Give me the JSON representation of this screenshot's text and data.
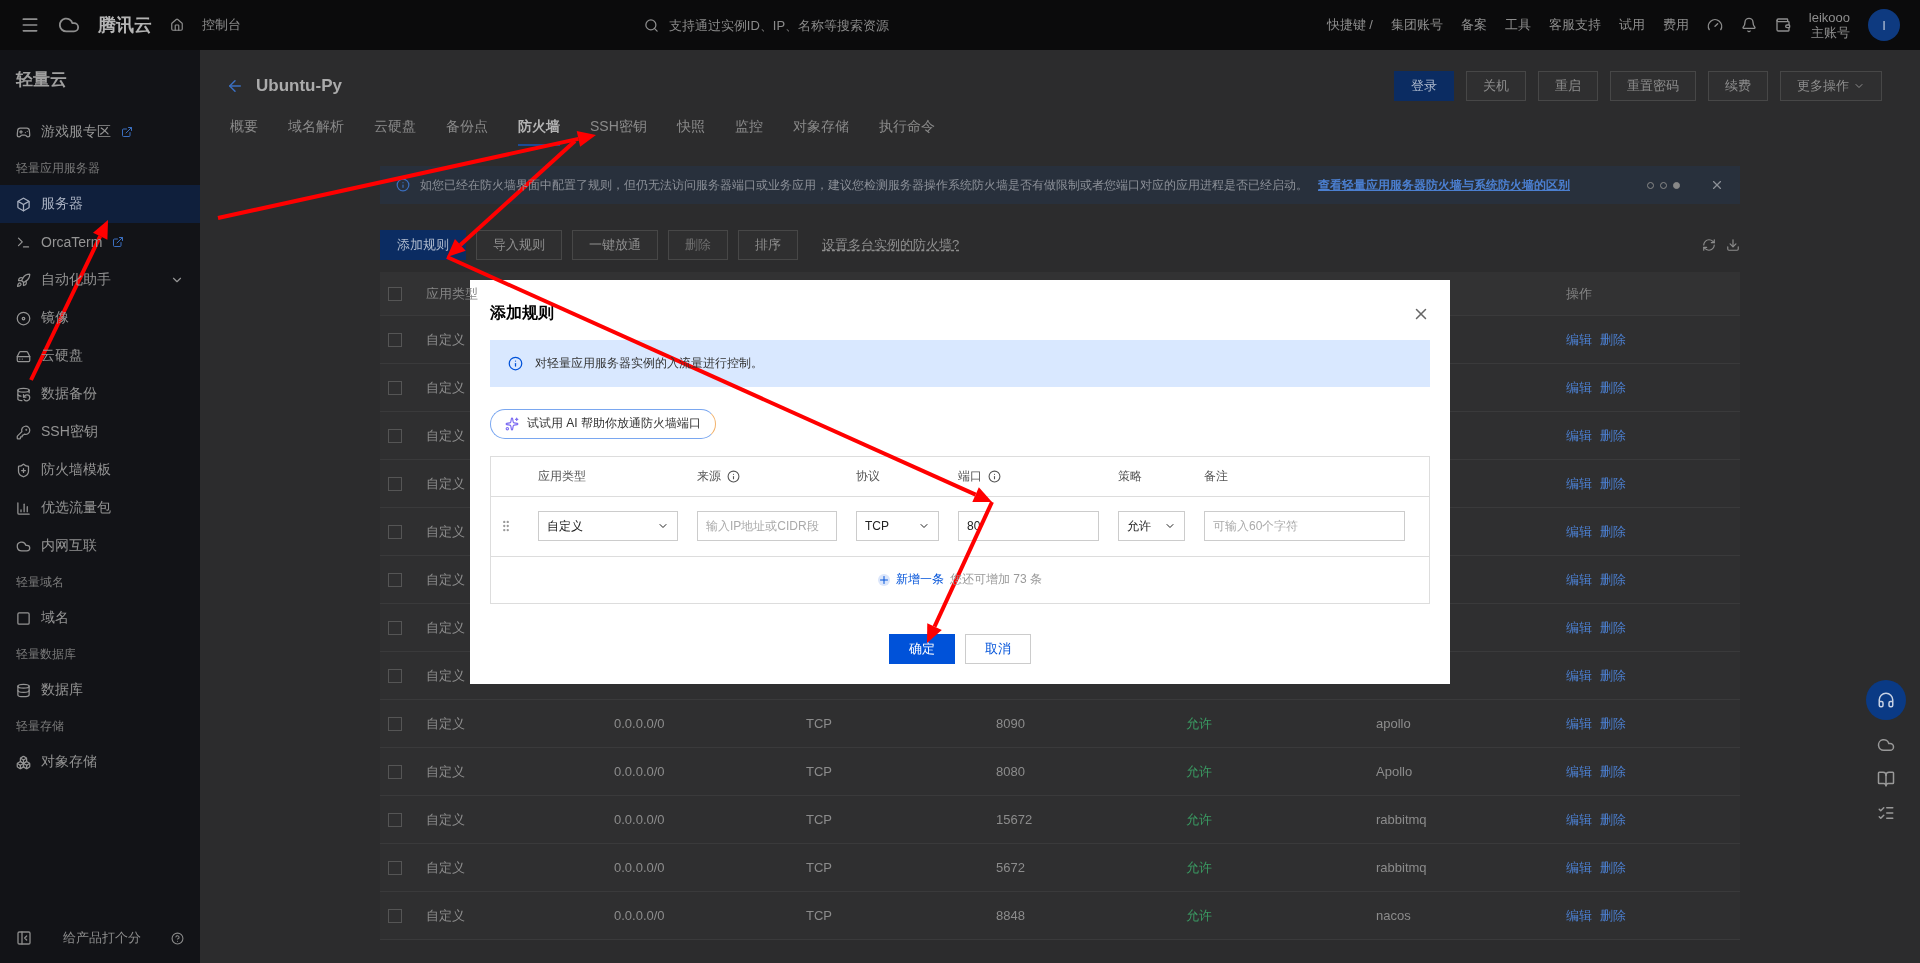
{
  "top_bar": {
    "brand": "腾讯云",
    "console": "控制台",
    "search": {
      "placeholder": "支持通过实例ID、IP、名称等搜索资源"
    },
    "shortcut": "快捷键 /",
    "links": [
      "集团账号",
      "备案",
      "工具",
      "客服支持",
      "试用",
      "费用"
    ],
    "user": {
      "name": "leikooo",
      "role": "主账号",
      "avatar": "I"
    }
  },
  "sidebar": {
    "title": "轻量云",
    "items": [
      {
        "kind": "item",
        "label": "游戏服专区",
        "external": true,
        "selected": false
      },
      {
        "kind": "section",
        "label": "轻量应用服务器"
      },
      {
        "kind": "item",
        "label": "服务器",
        "selected": true
      },
      {
        "kind": "item",
        "label": "OrcaTerm",
        "external": true,
        "selected": false
      },
      {
        "kind": "item",
        "label": "自动化助手",
        "expanded": false,
        "selected": false
      },
      {
        "kind": "item",
        "label": "镜像",
        "selected": false
      },
      {
        "kind": "item",
        "label": "云硬盘",
        "selected": false
      },
      {
        "kind": "item",
        "label": "数据备份",
        "selected": false
      },
      {
        "kind": "item",
        "label": "SSH密钥",
        "selected": false
      },
      {
        "kind": "item",
        "label": "防火墙模板",
        "selected": false
      },
      {
        "kind": "item",
        "label": "优选流量包",
        "selected": false
      },
      {
        "kind": "item",
        "label": "内网互联",
        "selected": false
      },
      {
        "kind": "section",
        "label": "轻量域名"
      },
      {
        "kind": "item",
        "label": "域名",
        "selected": false
      },
      {
        "kind": "section",
        "label": "轻量数据库"
      },
      {
        "kind": "item",
        "label": "数据库",
        "selected": false
      },
      {
        "kind": "section",
        "label": "轻量存储"
      },
      {
        "kind": "item",
        "label": "对象存储",
        "selected": false
      }
    ],
    "feedback": "给产品打个分"
  },
  "page": {
    "title": "Ubuntu-Py",
    "actions": [
      {
        "label": "登录",
        "primary": true
      },
      {
        "label": "关机",
        "primary": false
      },
      {
        "label": "重启",
        "primary": false
      },
      {
        "label": "重置密码",
        "primary": false
      },
      {
        "label": "续费",
        "primary": false
      },
      {
        "label": "更多操作",
        "primary": false,
        "menu": true
      }
    ],
    "tabs": [
      {
        "label": "概要",
        "selected": false
      },
      {
        "label": "域名解析",
        "selected": false
      },
      {
        "label": "云硬盘",
        "selected": false
      },
      {
        "label": "备份点",
        "selected": false
      },
      {
        "label": "防火墙",
        "selected": true
      },
      {
        "label": "SSH密钥",
        "selected": false
      },
      {
        "label": "快照",
        "selected": false
      },
      {
        "label": "监控",
        "selected": false
      },
      {
        "label": "对象存储",
        "selected": false
      },
      {
        "label": "执行命令",
        "selected": false
      }
    ],
    "alert": {
      "text": "如您已经在防火墙界面中配置了规则，但仍无法访问服务器端口或业务应用，建议您检测服务器操作系统防火墙是否有做限制或者您端口对应的应用进程是否已经启动。",
      "link": "查看轻量应用服务器防火墙与系统防火墙的区别",
      "pager": [
        {
          "selected": false
        },
        {
          "selected": false
        },
        {
          "selected": true
        }
      ]
    },
    "toolbar": {
      "buttons": [
        {
          "label": "添加规则",
          "primary": true,
          "disabled": false
        },
        {
          "label": "导入规则",
          "primary": false,
          "disabled": false
        },
        {
          "label": "一键放通",
          "primary": false,
          "disabled": false
        },
        {
          "label": "删除",
          "primary": false,
          "disabled": true
        },
        {
          "label": "排序",
          "primary": false,
          "disabled": false
        }
      ],
      "link": "设置多台实例的防火墙?"
    },
    "table": {
      "select_all_checked": false,
      "type_heading": "应用类型",
      "actions_heading": "操作",
      "rows": [
        {
          "checked": false,
          "app_type": "自定义",
          "actions": [
            "编辑",
            "删除"
          ]
        },
        {
          "checked": false,
          "app_type": "自定义",
          "actions": [
            "编辑",
            "删除"
          ]
        },
        {
          "checked": false,
          "app_type": "自定义",
          "actions": [
            "编辑",
            "删除"
          ]
        },
        {
          "checked": false,
          "app_type": "自定义",
          "actions": [
            "编辑",
            "删除"
          ]
        },
        {
          "checked": false,
          "app_type": "自定义",
          "actions": [
            "编辑",
            "删除"
          ]
        },
        {
          "checked": false,
          "app_type": "自定义",
          "actions": [
            "编辑",
            "删除"
          ]
        },
        {
          "checked": false,
          "app_type": "自定义",
          "actions": [
            "编辑",
            "删除"
          ]
        },
        {
          "checked": false,
          "app_type": "自定义",
          "actions": [
            "编辑",
            "删除"
          ]
        },
        {
          "checked": false,
          "app_type": "自定义",
          "source": "0.0.0.0/0",
          "protocol": "TCP",
          "port": "8090",
          "policy": "允许",
          "remark": "apollo",
          "actions": [
            "编辑",
            "删除"
          ]
        },
        {
          "checked": false,
          "app_type": "自定义",
          "source": "0.0.0.0/0",
          "protocol": "TCP",
          "port": "8080",
          "policy": "允许",
          "remark": "Apollo",
          "actions": [
            "编辑",
            "删除"
          ]
        },
        {
          "checked": false,
          "app_type": "自定义",
          "source": "0.0.0.0/0",
          "protocol": "TCP",
          "port": "15672",
          "policy": "允许",
          "remark": "rabbitmq",
          "actions": [
            "编辑",
            "删除"
          ]
        },
        {
          "checked": false,
          "app_type": "自定义",
          "source": "0.0.0.0/0",
          "protocol": "TCP",
          "port": "5672",
          "policy": "允许",
          "remark": "rabbitmq",
          "actions": [
            "编辑",
            "删除"
          ]
        },
        {
          "checked": false,
          "app_type": "自定义",
          "source": "0.0.0.0/0",
          "protocol": "TCP",
          "port": "8848",
          "policy": "允许",
          "remark": "nacos",
          "actions": [
            "编辑",
            "删除"
          ]
        }
      ]
    }
  },
  "modal": {
    "title": "添加规则",
    "info": "对轻量应用服务器实例的入流量进行控制。",
    "ai_button": "试试用 AI 帮助你放通防火墙端口",
    "columns": [
      {
        "label": "应用类型",
        "info": false
      },
      {
        "label": "来源",
        "info": true
      },
      {
        "label": "协议",
        "info": false
      },
      {
        "label": "端口",
        "info": true
      },
      {
        "label": "策略",
        "info": false
      },
      {
        "label": "备注",
        "info": false
      }
    ],
    "rule": {
      "app_type": "自定义",
      "source": {
        "placeholder": "输入IP地址或CIDR段"
      },
      "protocol": "TCP",
      "port": {
        "value": "80"
      },
      "policy": "允许",
      "remark": {
        "placeholder": "可输入60个字符"
      }
    },
    "add_link": "新增一条",
    "add_hint": "您还可增加 73 条",
    "buttons": [
      {
        "label": "确定",
        "primary": true
      },
      {
        "label": "取消",
        "primary": false
      }
    ]
  }
}
